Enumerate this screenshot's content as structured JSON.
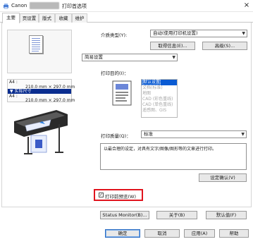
{
  "window": {
    "brand": "Canon",
    "title": "打印首选项",
    "close_glyph": "×",
    "app_icon": "printer-icon"
  },
  "tabs": [
    "主要",
    "页设置",
    "版式",
    "收藏",
    "维护"
  ],
  "preview": {
    "media_line1": "A4 :",
    "media_line2": "210.0 mm × 297.0 mm",
    "actual_size_label": "实际尺寸",
    "output_line1": "A4 :",
    "output_line2": "210.0 mm × 297.0 mm"
  },
  "media": {
    "label": "介质类型(Y):",
    "value": "自动(使用打印机设置)",
    "btn_get_info": "取得信息(E)...",
    "btn_settings": "高级(S)..."
  },
  "profile": {
    "value": "简易设置"
  },
  "purpose": {
    "label": "打印目的(I)：",
    "items": [
      "默认设置",
      "文档(标准)",
      "地图",
      "CAD (彩色重线)",
      "CAD (单色重线)",
      "遥感图、GIS"
    ],
    "selected_index": 0
  },
  "quality": {
    "label": "打印质量(Q)：",
    "value": "标准",
    "description": "以最合理的设定，对具有文字/图像/图形等的文章进行打印。",
    "btn_confirm": "设定确认(V)"
  },
  "preview_check": {
    "label": "打印前预览(W)",
    "checked": true
  },
  "footer": {
    "btn_status_monitor": "Status Monitor(B)...",
    "btn_about": "关于(B)",
    "btn_defaults": "默认值(F)",
    "btn_ok": "确定",
    "btn_cancel": "取消",
    "btn_apply": "应用(A)",
    "btn_help": "帮助"
  },
  "colors": {
    "accent": "#0a5bd3",
    "highlight_border": "#e0141e",
    "preview_band": "#0a2d8f"
  }
}
